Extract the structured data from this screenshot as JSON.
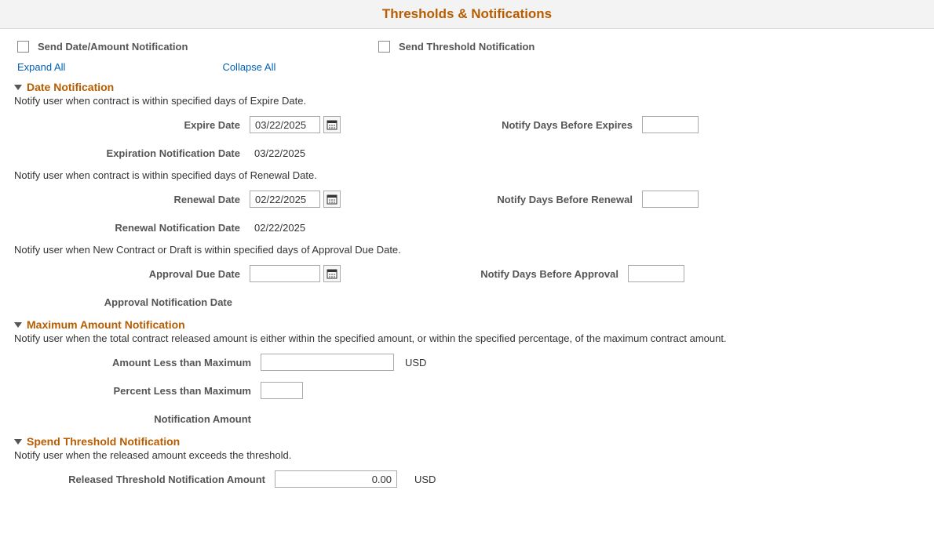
{
  "header": {
    "title": "Thresholds & Notifications"
  },
  "checkboxes": {
    "send_date_amount": "Send Date/Amount Notification",
    "send_threshold": "Send Threshold Notification"
  },
  "links": {
    "expand": "Expand All",
    "collapse": "Collapse All"
  },
  "date_notification": {
    "title": "Date Notification",
    "desc1": "Notify user when contract is within specified days of Expire Date.",
    "expire_date_label": "Expire Date",
    "expire_date_value": "03/22/2025",
    "notify_before_expires_label": "Notify Days Before Expires",
    "exp_notif_date_label": "Expiration Notification Date",
    "exp_notif_date_value": "03/22/2025",
    "desc2": "Notify user when contract is within specified days of Renewal Date.",
    "renewal_date_label": "Renewal Date",
    "renewal_date_value": "02/22/2025",
    "notify_before_renewal_label": "Notify Days Before Renewal",
    "ren_notif_date_label": "Renewal Notification Date",
    "ren_notif_date_value": "02/22/2025",
    "desc3": "Notify user when New Contract or Draft is within specified days of Approval Due Date.",
    "approval_due_label": "Approval Due Date",
    "notify_before_approval_label": "Notify Days Before Approval",
    "approval_notif_date_label": "Approval Notification Date"
  },
  "max_amount": {
    "title": "Maximum Amount Notification",
    "desc": "Notify user when the total contract released amount is either within the specified amount, or within the specified percentage, of the maximum contract amount.",
    "amount_less_label": "Amount Less than Maximum",
    "currency": "USD",
    "percent_less_label": "Percent Less than Maximum",
    "notif_amount_label": "Notification Amount"
  },
  "spend_threshold": {
    "title": "Spend Threshold Notification",
    "desc": "Notify user when the released amount exceeds the threshold.",
    "released_label": "Released Threshold Notification Amount",
    "released_value": "0.00",
    "currency": "USD"
  }
}
